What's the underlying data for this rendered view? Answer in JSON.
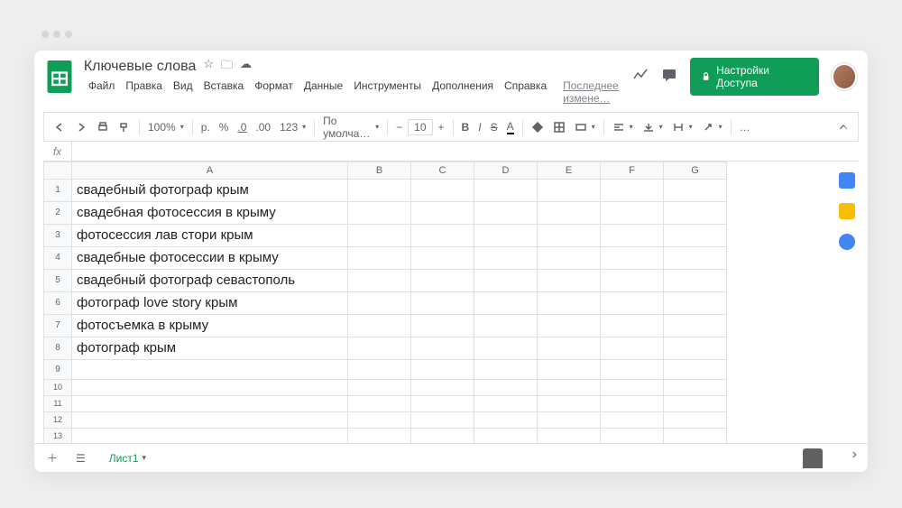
{
  "doc": {
    "title": "Ключевые слова"
  },
  "menus": [
    "Файл",
    "Правка",
    "Вид",
    "Вставка",
    "Формат",
    "Данные",
    "Инструменты",
    "Дополнения",
    "Справка"
  ],
  "last_edit": "Последнее измене…",
  "share_label": "Настройки Доступа",
  "toolbar": {
    "zoom": "100%",
    "currency": "р.",
    "percent": "%",
    "dec_dec": ".0",
    "dec_inc": ".00",
    "formats": "123",
    "font": "По умолча…",
    "size": "10",
    "more": "…"
  },
  "fx": "fx",
  "columns": [
    "A",
    "B",
    "C",
    "D",
    "E",
    "F",
    "G"
  ],
  "rows": [
    {
      "n": "1",
      "a": "свадебный фотограф крым",
      "tall": true
    },
    {
      "n": "2",
      "a": "свадебная фотосессия в крыму",
      "tall": true
    },
    {
      "n": "3",
      "a": "фотосессия лав стори крым",
      "tall": true
    },
    {
      "n": "4",
      "a": "свадебные фотосессии в крыму",
      "tall": true
    },
    {
      "n": "5",
      "a": "свадебный фотограф севастополь",
      "tall": true
    },
    {
      "n": "6",
      "a": "фотограф love story крым",
      "tall": true
    },
    {
      "n": "7",
      "a": "фотосъемка в крыму",
      "tall": true
    },
    {
      "n": "8",
      "a": "фотограф крым",
      "tall": true
    },
    {
      "n": "9",
      "a": "",
      "tall": false
    },
    {
      "n": "10",
      "a": "",
      "tall": false,
      "short": true
    },
    {
      "n": "11",
      "a": "",
      "tall": false,
      "short": true
    },
    {
      "n": "12",
      "a": "",
      "tall": false,
      "short": true
    },
    {
      "n": "13",
      "a": "",
      "tall": false,
      "short": true
    }
  ],
  "tab_label": "Лист1"
}
